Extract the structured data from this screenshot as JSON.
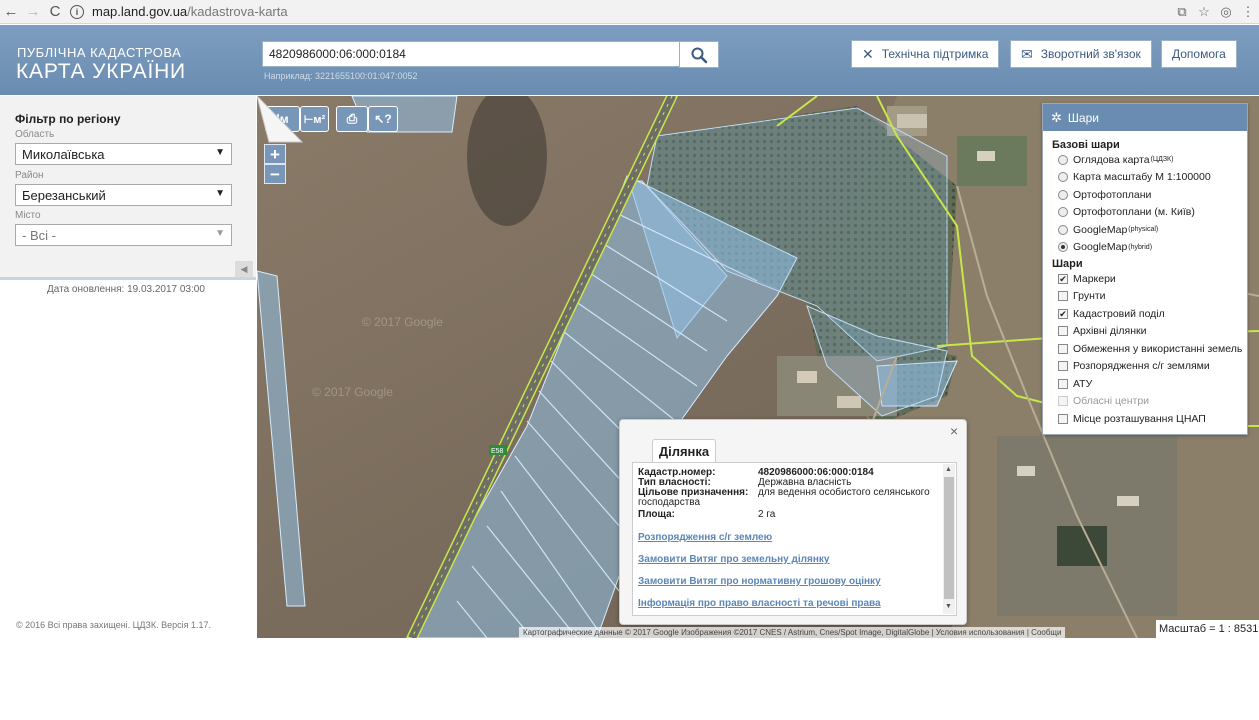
{
  "browser": {
    "url_host": "map.land.gov.ua",
    "url_path": "/kadastrova-karta"
  },
  "header": {
    "logo_line1": "ПУБЛІЧНА КАДАСТРОВА",
    "logo_line2": "КАРТА УКРАЇНИ",
    "search_value": "4820986000:06:000:0184",
    "search_hint": "Наприклад: 3221655100:01:047:0052",
    "buttons": {
      "support": "Технічна підтримка",
      "feedback": "Зворотний зв'язок",
      "help": "Допомога"
    }
  },
  "filter": {
    "title": "Фільтр по регіону",
    "oblast_label": "Область",
    "oblast_value": "Миколаївська",
    "rayon_label": "Район",
    "rayon_value": "Березанський",
    "city_label": "Місто",
    "city_value": "- Всі -",
    "update_date": "Дата оновлення: 19.03.2017 03:00"
  },
  "footer": {
    "copyright": "© 2016 Всі права захищені. ЦДЗК. Версія 1.17."
  },
  "map_tools": {
    "measure_line": "|м",
    "measure_area": "⊢м²",
    "zoom_in": "+",
    "zoom_out": "−"
  },
  "layers": {
    "title": "Шари",
    "base_title": "Базові шари",
    "base": [
      {
        "label": "Оглядова карта",
        "sup": "(ЦДЗК)",
        "selected": false
      },
      {
        "label": "Карта масштабу М 1:100000",
        "sup": "",
        "selected": false
      },
      {
        "label": "Ортофотоплани",
        "sup": "",
        "selected": false
      },
      {
        "label": "Ортофотоплани (м. Київ)",
        "sup": "",
        "selected": false
      },
      {
        "label": "GoogleMap",
        "sup": "(physical)",
        "selected": false
      },
      {
        "label": "GoogleMap",
        "sup": "(hybrid)",
        "selected": true
      }
    ],
    "overlay_title": "Шари",
    "overlays": [
      {
        "label": "Маркери",
        "checked": true,
        "disabled": false
      },
      {
        "label": "Грунти",
        "checked": false,
        "disabled": false
      },
      {
        "label": "Кадастровий поділ",
        "checked": true,
        "disabled": false
      },
      {
        "label": "Архівні ділянки",
        "checked": false,
        "disabled": false
      },
      {
        "label": "Обмеження у використанні земель",
        "checked": false,
        "disabled": false
      },
      {
        "label": "Розпорядження с/г землями",
        "checked": false,
        "disabled": false
      },
      {
        "label": "АТУ",
        "checked": false,
        "disabled": false
      },
      {
        "label": "Обласні центри",
        "checked": false,
        "disabled": true
      },
      {
        "label": "Місце розташування ЦНАП",
        "checked": false,
        "disabled": false
      }
    ]
  },
  "popup": {
    "tab": "Ділянка",
    "close": "×",
    "fields": {
      "cadastral_key": "Кадастр.номер:",
      "cadastral_value": "4820986000:06:000:0184",
      "ownership_key": "Тип власності:",
      "ownership_value": "Державна власність",
      "purpose_key": "Цільове призначення:",
      "purpose_value": "для ведення особистого селянського",
      "purpose_value_cont": "господарства",
      "area_key": "Площа:",
      "area_value": "2 га"
    },
    "links": [
      "Розпорядження с/г землею",
      "Замовити Витяг про земельну ділянку",
      "Замовити Витяг про нормативну грошову оцінку",
      "Інформація про право власності та речові права"
    ]
  },
  "map_footer": {
    "attribution": "Картографические данные © 2017 Google Изображения ©2017 CNES / Astrium, Cnes/Spot Image, DigitalGlobe | Условия использования | Сообщи",
    "scale": "Масштаб = 1 : 8531",
    "road_label": "E58",
    "watermark": "© 2017 Google"
  },
  "colors": {
    "header_bg": "#6a8cb0",
    "parcel_fill": "#8fc0e6",
    "parcel_line": "#cfe8ff",
    "road_green": "#c8e64a",
    "link": "#5b87b8"
  }
}
